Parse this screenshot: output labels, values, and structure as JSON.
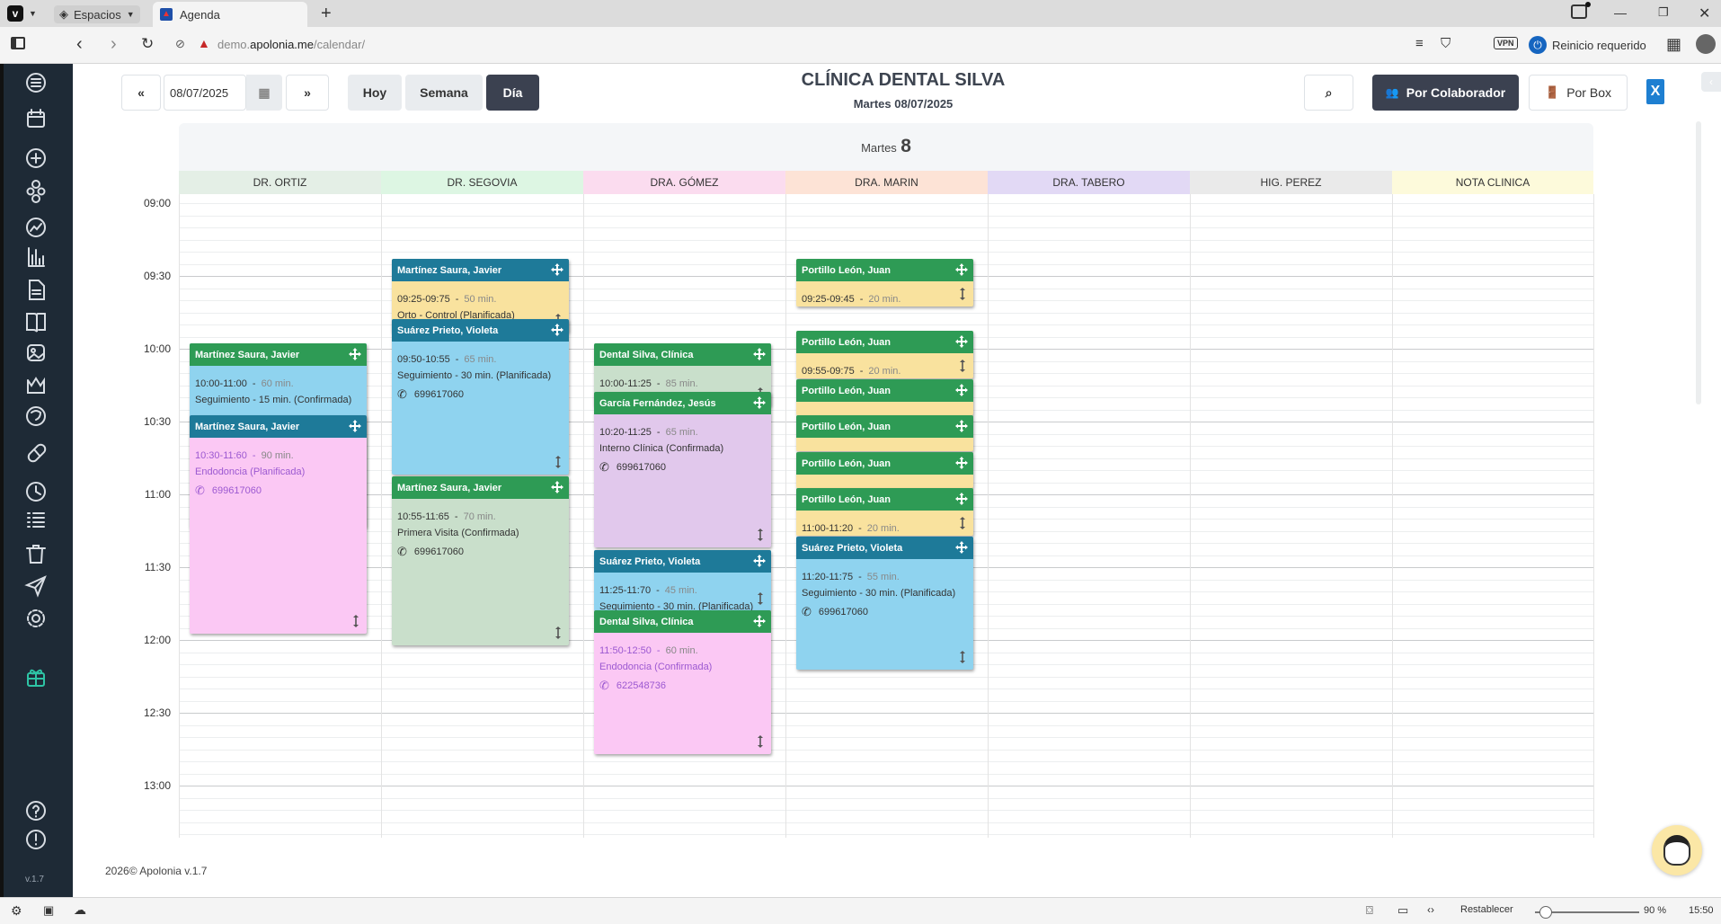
{
  "browser": {
    "spaces_label": "Espacios",
    "tab_title": "Agenda",
    "url_prefix": "demo.",
    "url_domain": "apolonia.me",
    "url_path": "/calendar/",
    "vpn_label": "VPN",
    "restart_label": "Reinicio requerido",
    "status": {
      "reset_label": "Restablecer",
      "zoom": "90 %",
      "clock": "15:50"
    }
  },
  "sidebar": {
    "version": "v.1.7"
  },
  "toolbar": {
    "prev_label": "«",
    "date_value": "08/07/2025",
    "next_label": "»",
    "today_label": "Hoy",
    "week_label": "Semana",
    "day_label": "Día",
    "clinic_title": "CLÍNICA DENTAL SILVA",
    "clinic_date": "Martes 08/07/2025",
    "by_collab_label": "Por Colaborador",
    "by_box_label": "Por Box"
  },
  "calendar": {
    "day_name": "Martes",
    "day_number": "8",
    "columns": [
      {
        "label": "DR. ORTIZ",
        "color": "#e4efe6"
      },
      {
        "label": "DR. SEGOVIA",
        "color": "#ddf6e3"
      },
      {
        "label": "DRA. GÓMEZ",
        "color": "#fbdcef"
      },
      {
        "label": "DRA. MARIN",
        "color": "#fde3d6"
      },
      {
        "label": "DRA. TABERO",
        "color": "#e2d9f5"
      },
      {
        "label": "HIG. PEREZ",
        "color": "#eaeaea"
      },
      {
        "label": "NOTA CLINICA",
        "color": "#fdfadb"
      }
    ],
    "times": [
      "09:00",
      "09:30",
      "10:00",
      "10:30",
      "11:00",
      "11:30",
      "12:00",
      "12:30",
      "13:00"
    ],
    "appointments": [
      {
        "name": "Martínez Saura, Javier",
        "time": "10:00-11:00",
        "dur": "60 min.",
        "desc": "Seguimiento - 15 min. (Confirmada)",
        "phone": ""
      },
      {
        "name": "Martínez Saura, Javier",
        "time": "10:30-11:60",
        "dur": "90 min.",
        "desc": "Endodoncia (Planificada)",
        "phone": "699617060"
      },
      {
        "name": "Martínez Saura, Javier",
        "time": "09:25-09:75",
        "dur": "50 min.",
        "desc": "Orto - Control (Planificada)",
        "phone": ""
      },
      {
        "name": "Suárez Prieto, Violeta",
        "time": "09:50-10:55",
        "dur": "65 min.",
        "desc": "Seguimiento - 30 min. (Planificada)",
        "phone": "699617060"
      },
      {
        "name": "Martínez Saura, Javier",
        "time": "10:55-11:65",
        "dur": "70 min.",
        "desc": "Primera Visita (Confirmada)",
        "phone": "699617060"
      },
      {
        "name": "Dental Silva, Clínica",
        "time": "10:00-11:25",
        "dur": "85 min.",
        "desc": "",
        "phone": ""
      },
      {
        "name": "García Fernández, Jesús",
        "time": "10:20-11:25",
        "dur": "65 min.",
        "desc": "Interno Clínica (Confirmada)",
        "phone": "699617060"
      },
      {
        "name": "Suárez Prieto, Violeta",
        "time": "11:25-11:70",
        "dur": "45 min.",
        "desc": "Seguimiento - 30 min. (Planificada)",
        "phone": ""
      },
      {
        "name": "Dental Silva, Clínica",
        "time": "11:50-12:50",
        "dur": "60 min.",
        "desc": "Endodoncia (Confirmada)",
        "phone": "622548736"
      },
      {
        "name": "Portillo León, Juan",
        "time": "09:25-09:45",
        "dur": "20 min.",
        "desc": "",
        "phone": ""
      },
      {
        "name": "Portillo León, Juan",
        "time": "09:55-09:75",
        "dur": "20 min.",
        "desc": "",
        "phone": ""
      },
      {
        "name": "Portillo León, Juan",
        "time": "",
        "dur": "",
        "desc": "",
        "phone": ""
      },
      {
        "name": "Portillo León, Juan",
        "time": "",
        "dur": "",
        "desc": "",
        "phone": ""
      },
      {
        "name": "Portillo León, Juan",
        "time": "",
        "dur": "",
        "desc": "",
        "phone": ""
      },
      {
        "name": "Portillo León, Juan",
        "time": "11:00-11:20",
        "dur": "20 min.",
        "desc": "",
        "phone": ""
      },
      {
        "name": "Suárez Prieto, Violeta",
        "time": "11:20-11:75",
        "dur": "55 min.",
        "desc": "Seguimiento - 30 min. (Planificada)",
        "phone": "699617060"
      }
    ]
  },
  "footer": {
    "copyright": "2026© Apolonia v.1.7"
  },
  "colors": {
    "sidebar": "#1e2a36",
    "header_green": "#2e9b55",
    "header_teal": "#1e7a99",
    "card_blue": "#8fd3ef",
    "card_pink": "#fbc8f4",
    "card_sage": "#c9dfcb",
    "card_lilac": "#e1c8ec",
    "card_yellow": "#f9e29e"
  }
}
